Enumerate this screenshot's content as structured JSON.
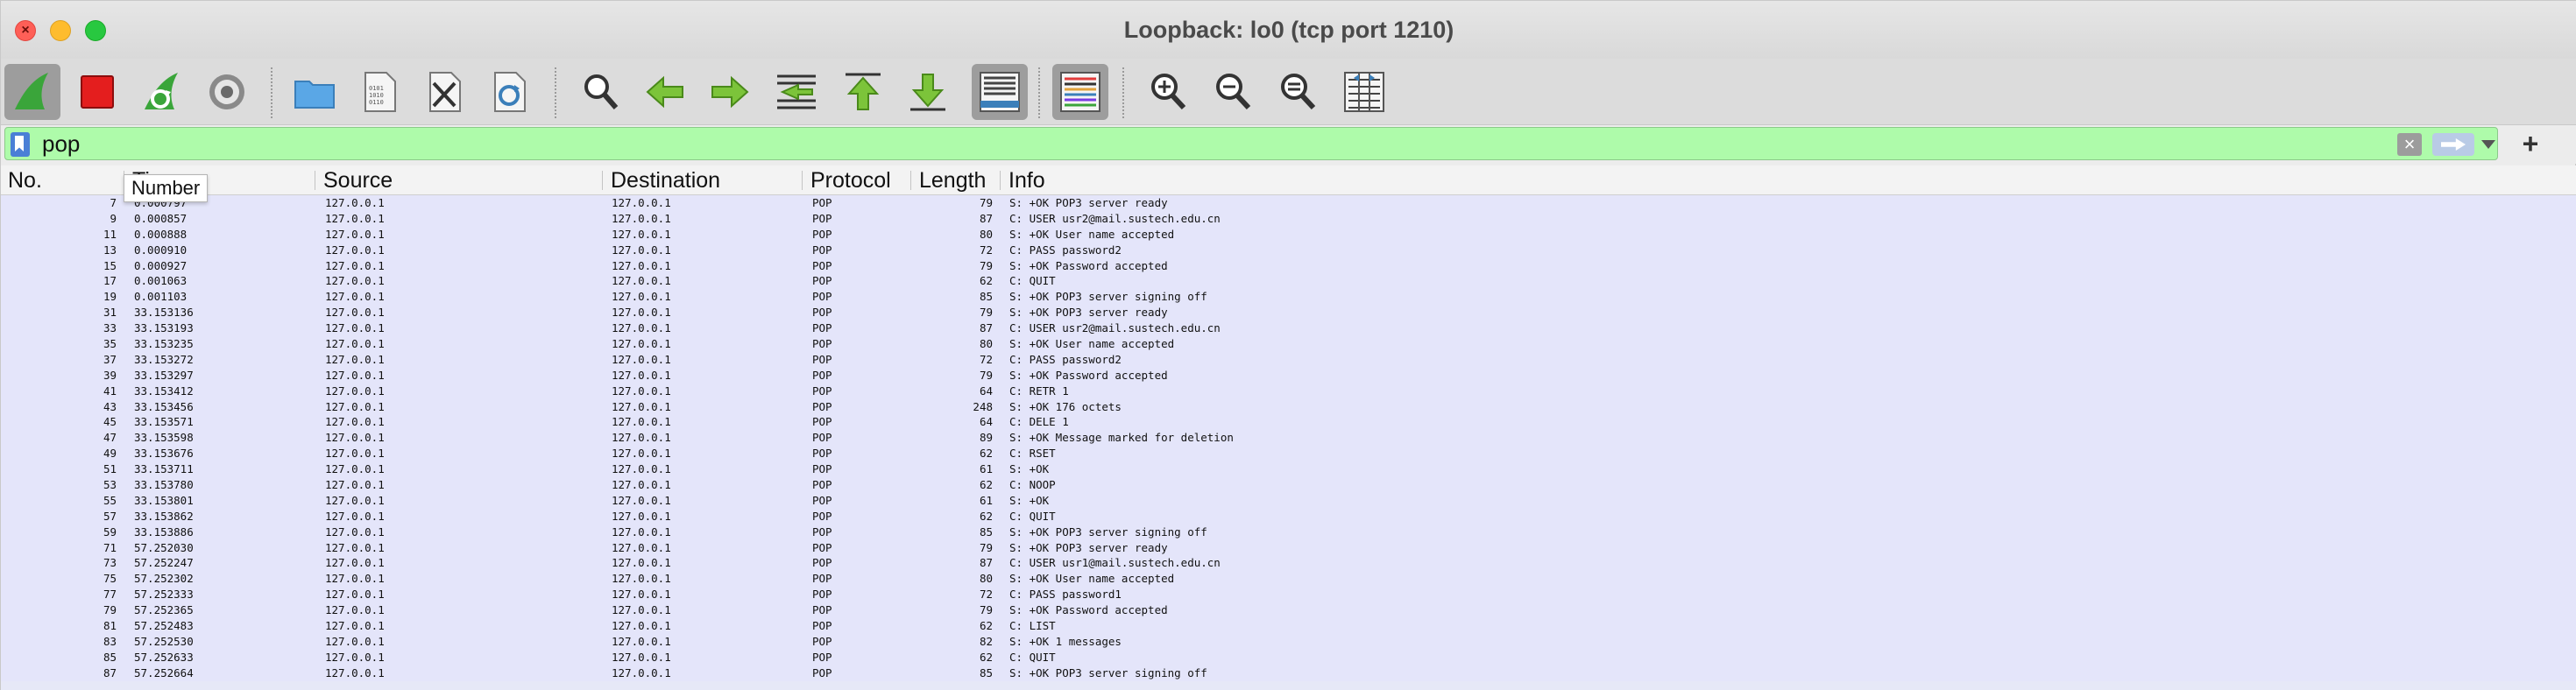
{
  "window": {
    "title": "Loopback: lo0 (tcp port 1210)"
  },
  "toolbar": {
    "buttons": [
      {
        "icon": "shark-fin-start-icon"
      },
      {
        "icon": "stop-capture-icon"
      },
      {
        "icon": "restart-capture-icon"
      },
      {
        "icon": "capture-options-icon"
      },
      {
        "icon": "open-file-icon"
      },
      {
        "icon": "save-file-icon"
      },
      {
        "icon": "close-file-icon"
      },
      {
        "icon": "reload-file-icon"
      },
      {
        "icon": "find-packet-icon"
      },
      {
        "icon": "go-back-icon"
      },
      {
        "icon": "go-forward-icon"
      },
      {
        "icon": "go-to-packet-icon"
      },
      {
        "icon": "go-first-packet-icon"
      },
      {
        "icon": "go-last-packet-icon"
      },
      {
        "icon": "auto-scroll-icon"
      },
      {
        "icon": "colorize-icon"
      },
      {
        "icon": "zoom-in-icon"
      },
      {
        "icon": "zoom-out-icon"
      },
      {
        "icon": "normal-size-icon"
      },
      {
        "icon": "resize-columns-icon"
      }
    ]
  },
  "filter": {
    "value": "pop"
  },
  "columns": {
    "no": "No.",
    "time": "Time",
    "source": "Source",
    "destination": "Destination",
    "protocol": "Protocol",
    "length": "Length",
    "info": "Info"
  },
  "tooltip": {
    "text": "Number"
  },
  "packets": [
    {
      "no": "7",
      "time": "0.000797",
      "src": "127.0.0.1",
      "dst": "127.0.0.1",
      "proto": "POP",
      "len": "79",
      "info": "S: +OK POP3 server ready"
    },
    {
      "no": "9",
      "time": "0.000857",
      "src": "127.0.0.1",
      "dst": "127.0.0.1",
      "proto": "POP",
      "len": "87",
      "info": "C: USER usr2@mail.sustech.edu.cn"
    },
    {
      "no": "11",
      "time": "0.000888",
      "src": "127.0.0.1",
      "dst": "127.0.0.1",
      "proto": "POP",
      "len": "80",
      "info": "S: +OK User name accepted"
    },
    {
      "no": "13",
      "time": "0.000910",
      "src": "127.0.0.1",
      "dst": "127.0.0.1",
      "proto": "POP",
      "len": "72",
      "info": "C: PASS password2"
    },
    {
      "no": "15",
      "time": "0.000927",
      "src": "127.0.0.1",
      "dst": "127.0.0.1",
      "proto": "POP",
      "len": "79",
      "info": "S: +OK Password accepted"
    },
    {
      "no": "17",
      "time": "0.001063",
      "src": "127.0.0.1",
      "dst": "127.0.0.1",
      "proto": "POP",
      "len": "62",
      "info": "C: QUIT"
    },
    {
      "no": "19",
      "time": "0.001103",
      "src": "127.0.0.1",
      "dst": "127.0.0.1",
      "proto": "POP",
      "len": "85",
      "info": "S: +OK POP3 server signing off"
    },
    {
      "no": "31",
      "time": "33.153136",
      "src": "127.0.0.1",
      "dst": "127.0.0.1",
      "proto": "POP",
      "len": "79",
      "info": "S: +OK POP3 server ready"
    },
    {
      "no": "33",
      "time": "33.153193",
      "src": "127.0.0.1",
      "dst": "127.0.0.1",
      "proto": "POP",
      "len": "87",
      "info": "C: USER usr2@mail.sustech.edu.cn"
    },
    {
      "no": "35",
      "time": "33.153235",
      "src": "127.0.0.1",
      "dst": "127.0.0.1",
      "proto": "POP",
      "len": "80",
      "info": "S: +OK User name accepted"
    },
    {
      "no": "37",
      "time": "33.153272",
      "src": "127.0.0.1",
      "dst": "127.0.0.1",
      "proto": "POP",
      "len": "72",
      "info": "C: PASS password2"
    },
    {
      "no": "39",
      "time": "33.153297",
      "src": "127.0.0.1",
      "dst": "127.0.0.1",
      "proto": "POP",
      "len": "79",
      "info": "S: +OK Password accepted"
    },
    {
      "no": "41",
      "time": "33.153412",
      "src": "127.0.0.1",
      "dst": "127.0.0.1",
      "proto": "POP",
      "len": "64",
      "info": "C: RETR 1"
    },
    {
      "no": "43",
      "time": "33.153456",
      "src": "127.0.0.1",
      "dst": "127.0.0.1",
      "proto": "POP",
      "len": "248",
      "info": "S: +OK 176 octets"
    },
    {
      "no": "45",
      "time": "33.153571",
      "src": "127.0.0.1",
      "dst": "127.0.0.1",
      "proto": "POP",
      "len": "64",
      "info": "C: DELE 1"
    },
    {
      "no": "47",
      "time": "33.153598",
      "src": "127.0.0.1",
      "dst": "127.0.0.1",
      "proto": "POP",
      "len": "89",
      "info": "S: +OK Message marked for deletion"
    },
    {
      "no": "49",
      "time": "33.153676",
      "src": "127.0.0.1",
      "dst": "127.0.0.1",
      "proto": "POP",
      "len": "62",
      "info": "C: RSET"
    },
    {
      "no": "51",
      "time": "33.153711",
      "src": "127.0.0.1",
      "dst": "127.0.0.1",
      "proto": "POP",
      "len": "61",
      "info": "S: +OK"
    },
    {
      "no": "53",
      "time": "33.153780",
      "src": "127.0.0.1",
      "dst": "127.0.0.1",
      "proto": "POP",
      "len": "62",
      "info": "C: NOOP"
    },
    {
      "no": "55",
      "time": "33.153801",
      "src": "127.0.0.1",
      "dst": "127.0.0.1",
      "proto": "POP",
      "len": "61",
      "info": "S: +OK"
    },
    {
      "no": "57",
      "time": "33.153862",
      "src": "127.0.0.1",
      "dst": "127.0.0.1",
      "proto": "POP",
      "len": "62",
      "info": "C: QUIT"
    },
    {
      "no": "59",
      "time": "33.153886",
      "src": "127.0.0.1",
      "dst": "127.0.0.1",
      "proto": "POP",
      "len": "85",
      "info": "S: +OK POP3 server signing off"
    },
    {
      "no": "71",
      "time": "57.252030",
      "src": "127.0.0.1",
      "dst": "127.0.0.1",
      "proto": "POP",
      "len": "79",
      "info": "S: +OK POP3 server ready"
    },
    {
      "no": "73",
      "time": "57.252247",
      "src": "127.0.0.1",
      "dst": "127.0.0.1",
      "proto": "POP",
      "len": "87",
      "info": "C: USER usr1@mail.sustech.edu.cn"
    },
    {
      "no": "75",
      "time": "57.252302",
      "src": "127.0.0.1",
      "dst": "127.0.0.1",
      "proto": "POP",
      "len": "80",
      "info": "S: +OK User name accepted"
    },
    {
      "no": "77",
      "time": "57.252333",
      "src": "127.0.0.1",
      "dst": "127.0.0.1",
      "proto": "POP",
      "len": "72",
      "info": "C: PASS password1"
    },
    {
      "no": "79",
      "time": "57.252365",
      "src": "127.0.0.1",
      "dst": "127.0.0.1",
      "proto": "POP",
      "len": "79",
      "info": "S: +OK Password accepted"
    },
    {
      "no": "81",
      "time": "57.252483",
      "src": "127.0.0.1",
      "dst": "127.0.0.1",
      "proto": "POP",
      "len": "62",
      "info": "C: LIST"
    },
    {
      "no": "83",
      "time": "57.252530",
      "src": "127.0.0.1",
      "dst": "127.0.0.1",
      "proto": "POP",
      "len": "82",
      "info": "S: +OK 1 messages"
    },
    {
      "no": "85",
      "time": "57.252633",
      "src": "127.0.0.1",
      "dst": "127.0.0.1",
      "proto": "POP",
      "len": "62",
      "info": "C: QUIT"
    },
    {
      "no": "87",
      "time": "57.252664",
      "src": "127.0.0.1",
      "dst": "127.0.0.1",
      "proto": "POP",
      "len": "85",
      "info": "S: +OK POP3 server signing off"
    }
  ]
}
